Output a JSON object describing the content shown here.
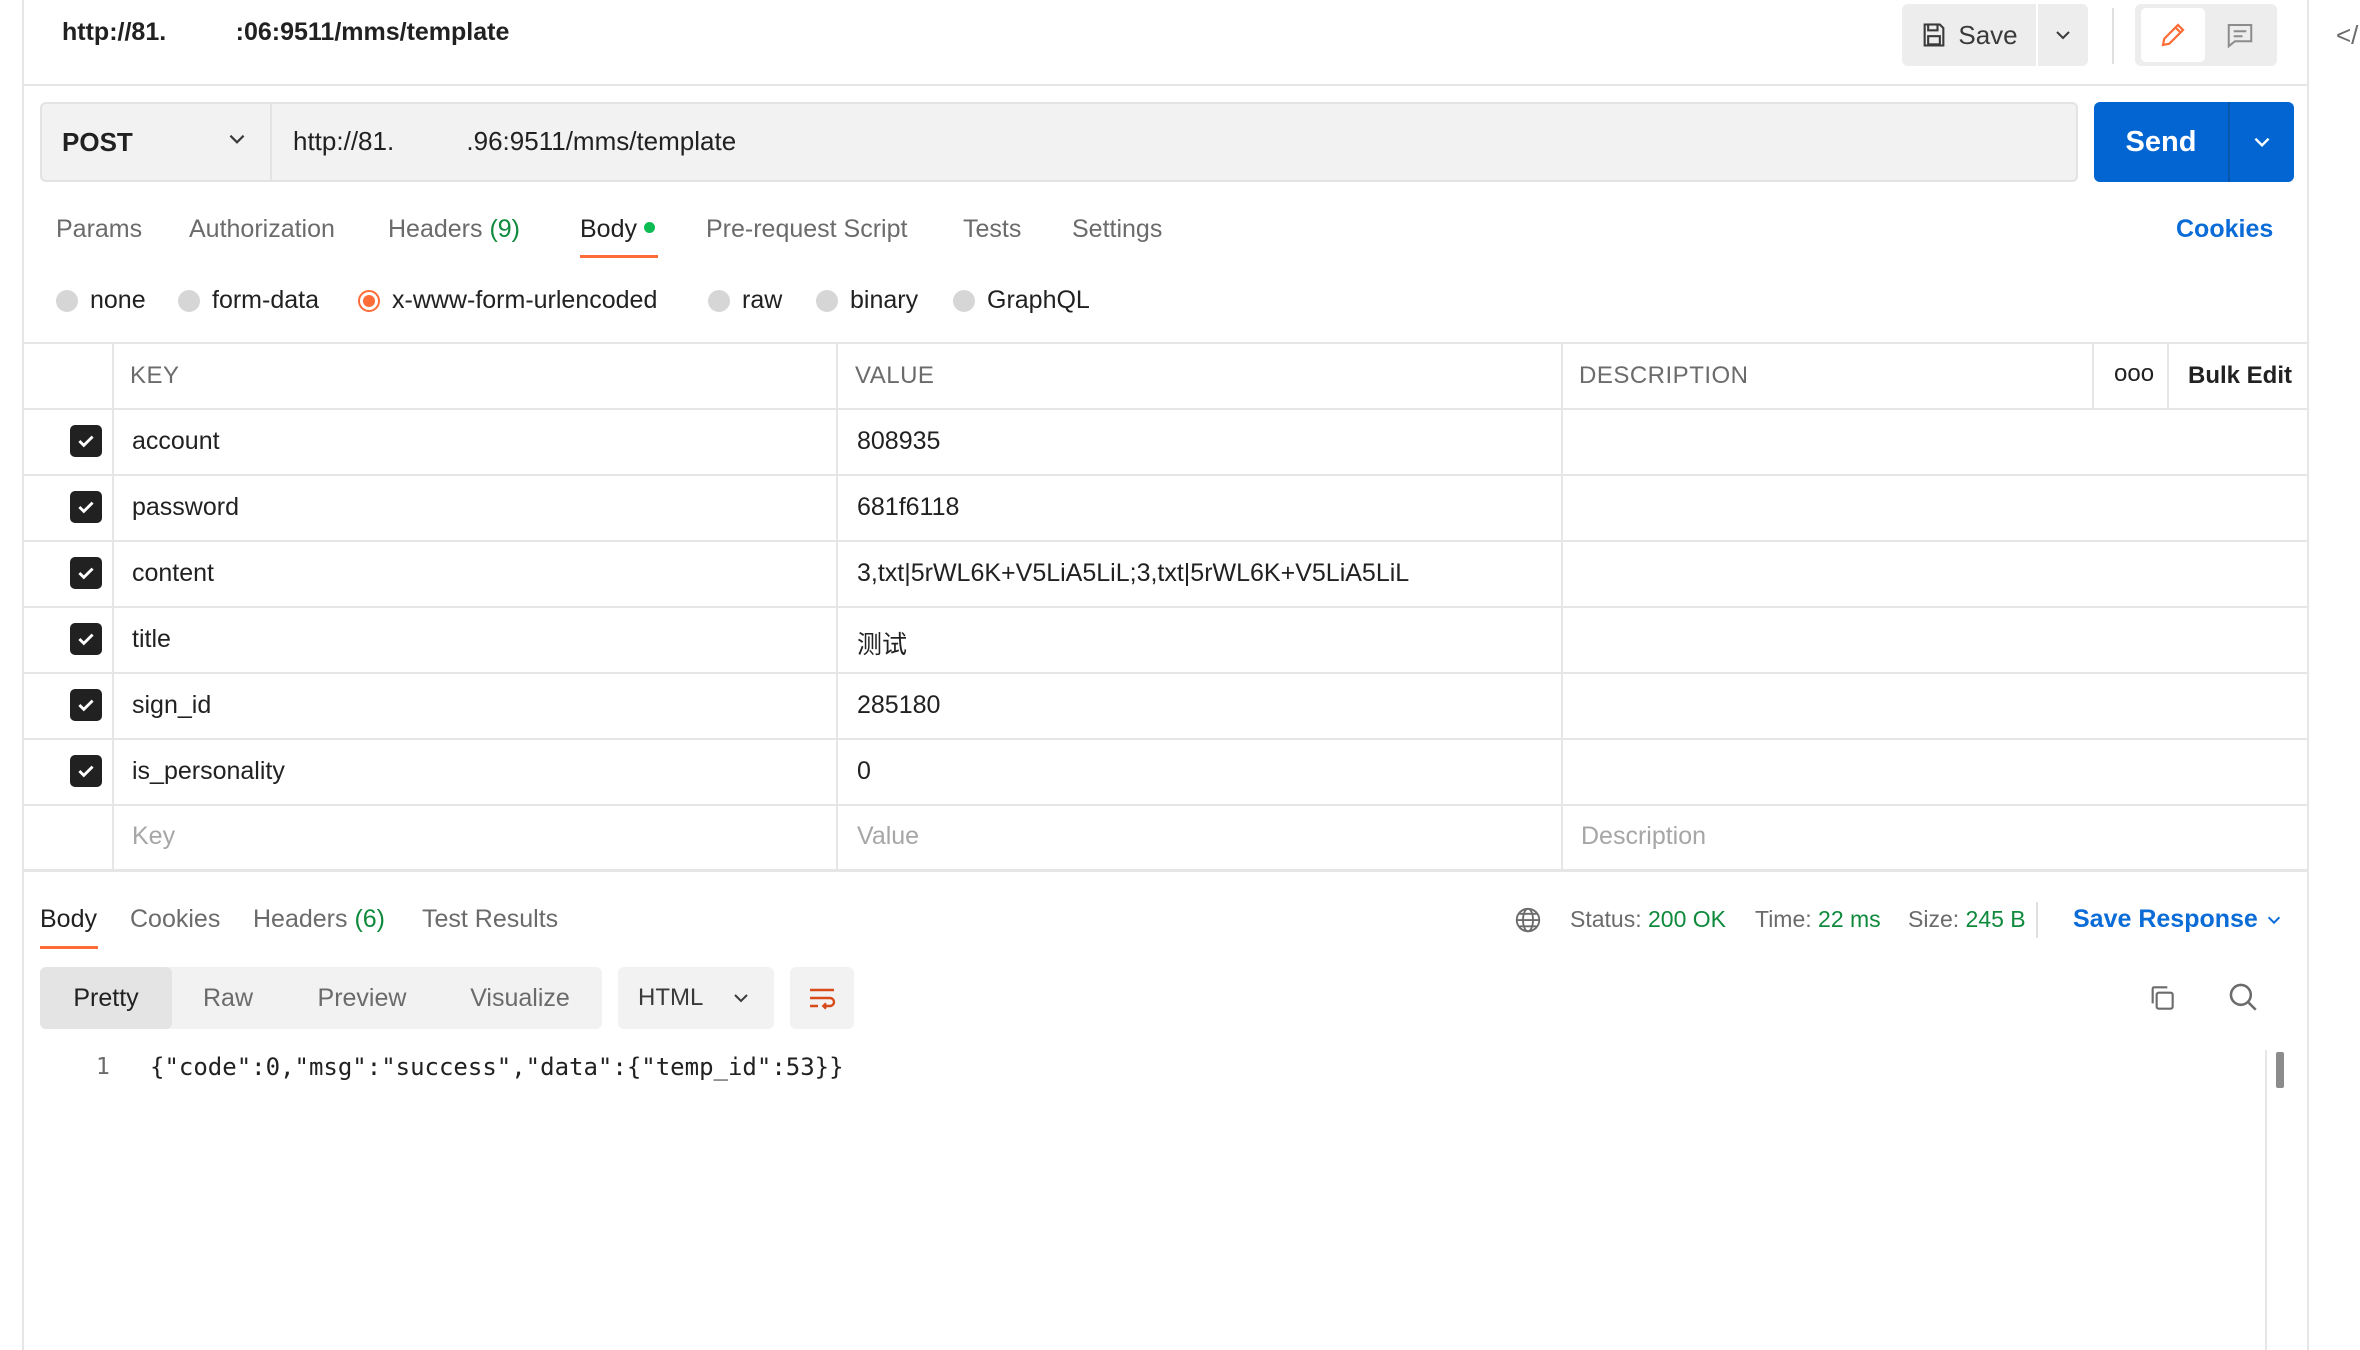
{
  "tab": {
    "title": "http://81.          :06:9511/mms/template"
  },
  "toolbar": {
    "save_label": "Save"
  },
  "request": {
    "method": "POST",
    "url": "http://81.          .96:9511/mms/template",
    "send_label": "Send"
  },
  "request_tabs": [
    {
      "label": "Params"
    },
    {
      "label": "Authorization"
    },
    {
      "label": "Headers",
      "count": "(9)"
    },
    {
      "label": "Body"
    },
    {
      "label": "Pre-request Script"
    },
    {
      "label": "Tests"
    },
    {
      "label": "Settings"
    }
  ],
  "cookies_label": "Cookies",
  "body_types": [
    "none",
    "form-data",
    "x-www-form-urlencoded",
    "raw",
    "binary",
    "GraphQL"
  ],
  "body_type_selected": "x-www-form-urlencoded",
  "table": {
    "headers": {
      "key": "KEY",
      "value": "VALUE",
      "description": "DESCRIPTION",
      "bulk_edit": "Bulk Edit",
      "more": "ooo"
    },
    "rows": [
      {
        "key": "account",
        "value": "808935",
        "checked": true
      },
      {
        "key": "password",
        "value": "681f6118",
        "checked": true
      },
      {
        "key": "content",
        "value": "3,txt|5rWL6K+V5LiA5LiL;3,txt|5rWL6K+V5LiA5LiL",
        "checked": true
      },
      {
        "key": "title",
        "value": "测试",
        "checked": true
      },
      {
        "key": "sign_id",
        "value": "285180",
        "checked": true
      },
      {
        "key": "is_personality",
        "value": "0",
        "checked": true
      }
    ],
    "placeholders": {
      "key": "Key",
      "value": "Value",
      "description": "Description"
    }
  },
  "response": {
    "tabs": [
      {
        "label": "Body"
      },
      {
        "label": "Cookies"
      },
      {
        "label": "Headers",
        "count": "(6)"
      },
      {
        "label": "Test Results"
      }
    ],
    "status_label": "Status:",
    "status_value": "200 OK",
    "time_label": "Time:",
    "time_value": "22 ms",
    "size_label": "Size:",
    "size_value": "245 B",
    "save_response_label": "Save Response",
    "views": [
      "Pretty",
      "Raw",
      "Preview",
      "Visualize"
    ],
    "format": "HTML",
    "line_number": "1",
    "code": "{\"code\":0,\"msg\":\"success\",\"data\":{\"temp_id\":53}}"
  },
  "colors": {
    "accent": "#ff6c37",
    "primary": "#0265d2",
    "success": "#0f8a3c"
  }
}
